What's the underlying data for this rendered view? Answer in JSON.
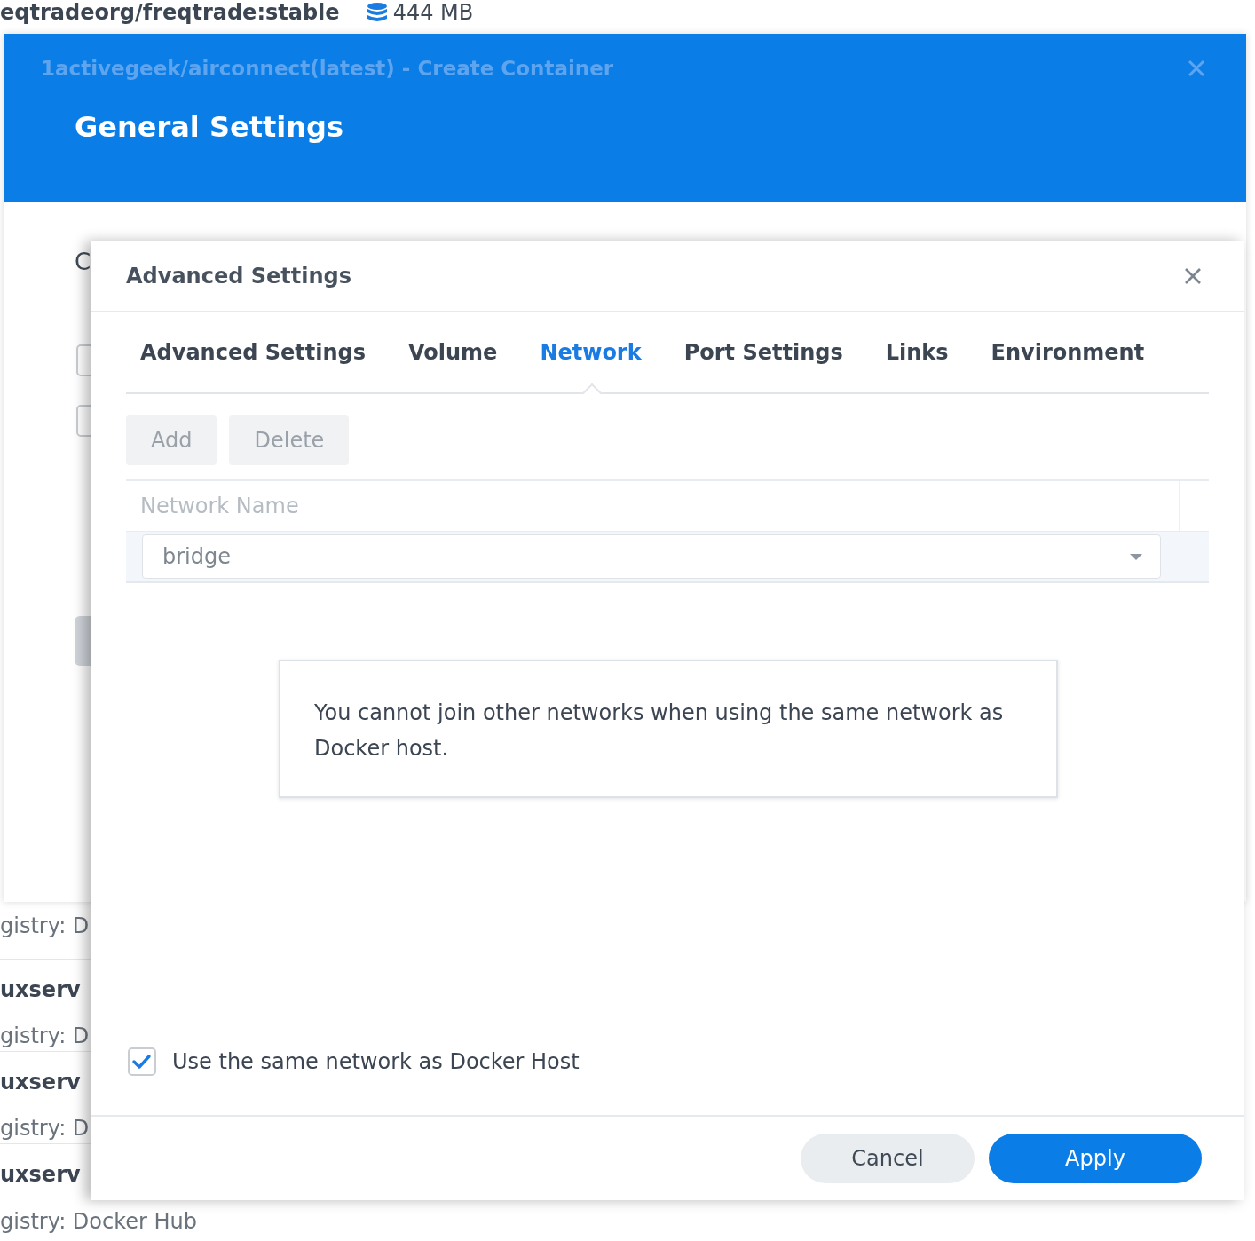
{
  "background": {
    "image_name": "eqtradeorg/freqtrade:stable",
    "size": "444 MB",
    "rows": [
      {
        "name": "uxserv",
        "registry": "gistry: D"
      },
      {
        "name": "uxserv",
        "registry": "gistry: D"
      },
      {
        "name": "uxserv",
        "registry": "gistry: Docker Hub"
      }
    ],
    "top_registry": "gistry: D"
  },
  "create_window": {
    "title": "1activegeek/airconnect(latest) - Create Container",
    "heading": "General Settings",
    "fragment": "C",
    "checkboxes": [
      {
        "checked": false
      },
      {
        "checked": false
      }
    ]
  },
  "dialog": {
    "title": "Advanced Settings",
    "tabs": [
      {
        "label": "Advanced Settings",
        "selected": false
      },
      {
        "label": "Volume",
        "selected": false
      },
      {
        "label": "Network",
        "selected": true
      },
      {
        "label": "Port Settings",
        "selected": false
      },
      {
        "label": "Links",
        "selected": false
      },
      {
        "label": "Environment",
        "selected": false
      }
    ],
    "toolbar": [
      {
        "label": "Add",
        "disabled": true
      },
      {
        "label": "Delete",
        "disabled": true
      }
    ],
    "table": {
      "columns": [
        "Network Name"
      ],
      "rows": [
        {
          "network": "bridge",
          "disabled": true
        }
      ]
    },
    "notice": "You cannot join other networks when using the same network as Docker host.",
    "host_network": {
      "label": "Use the same network as Docker Host",
      "checked": true
    },
    "buttons": [
      {
        "label": "Cancel",
        "kind": "secondary"
      },
      {
        "label": "Apply",
        "kind": "primary"
      }
    ]
  }
}
